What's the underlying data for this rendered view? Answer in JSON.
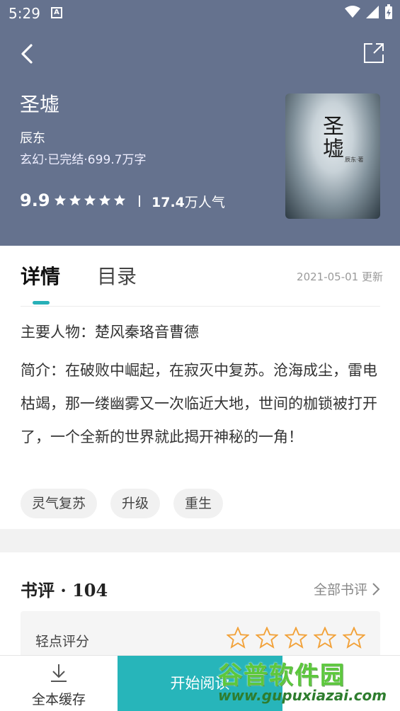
{
  "status": {
    "time": "5:29",
    "badge": "A"
  },
  "book": {
    "title": "圣墟",
    "author": "辰东",
    "meta": "玄幻·已完结·699.7万字",
    "score": "9.9",
    "stars_filled": 5,
    "popularity_value": "17.4",
    "popularity_unit": "万人气",
    "cover_title": "圣墟",
    "cover_author": "辰东·著"
  },
  "tabs": [
    {
      "label": "详情",
      "active": true
    },
    {
      "label": "目录",
      "active": false
    }
  ],
  "detail": {
    "update_date": "2021-05-01 更新",
    "characters": "主要人物：楚风秦珞音曹德",
    "synopsis": "简介：在破败中崛起，在寂灭中复苏。沧海成尘，雷电枯竭，那一缕幽雾又一次临近大地，世间的枷锁被打开了，一个全新的世界就此揭开神秘的一角！",
    "tags": [
      "灵气复苏",
      "升级",
      "重生"
    ]
  },
  "reviews": {
    "title": "书评 · 104",
    "all_label": "全部书评",
    "rate_label": "轻点评分",
    "rate_stars": 5
  },
  "bottom": {
    "cache_label": "全本缓存",
    "read_label": "开始阅读"
  },
  "watermark": {
    "main": "谷普软件园",
    "url": "www.gupuxiazai.com"
  },
  "colors": {
    "header_bg": "#65728e",
    "accent": "#27b5ba",
    "star_outline": "#f2a23a"
  }
}
